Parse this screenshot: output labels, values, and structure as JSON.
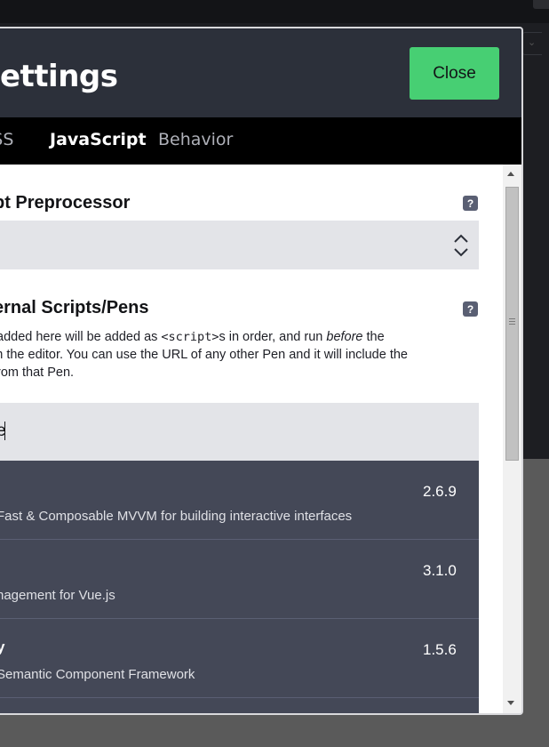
{
  "modal": {
    "title": "Settings",
    "close_label": "Close"
  },
  "tabs": [
    {
      "label": "CSS"
    },
    {
      "label": "JavaScript"
    },
    {
      "label": "Behavior"
    }
  ],
  "preprocessor": {
    "title": "pt Preprocessor",
    "help": "?"
  },
  "external": {
    "title": "ernal Scripts/Pens",
    "help": "?",
    "desc_line1_a": "added here will be added as ",
    "desc_code": "<script>",
    "desc_line1_b": "s in order, and run ",
    "desc_before": "before",
    "desc_line1_c": " the",
    "desc_line2": " in the editor. You can use the URL of any other Pen and it will include the",
    "desc_line3": " from that Pen."
  },
  "search": {
    "value": "e"
  },
  "results": [
    {
      "name": "",
      "description": "Fast & Composable MVVM for building interactive interfaces",
      "version": "2.6.9"
    },
    {
      "name": "",
      "description": "nagement for Vue.js",
      "version": "3.1.0"
    },
    {
      "name": "y",
      "description": "Semantic Component Framework",
      "version": "1.5.6"
    }
  ],
  "colors": {
    "header": "#2c303a",
    "accent": "#47cf73",
    "tabs": "#000000",
    "results_bg": "#444857",
    "input_bg": "#e3e4e8"
  },
  "icons": {
    "help": "help-icon",
    "select": "up-down-arrows-icon"
  }
}
